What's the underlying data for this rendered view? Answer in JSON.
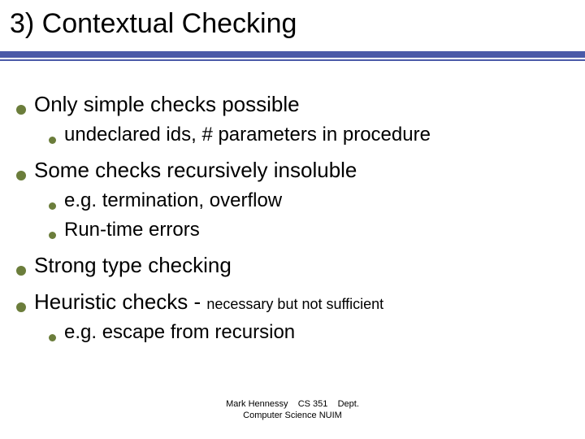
{
  "title": "3) Contextual Checking",
  "items": {
    "p1_lead": "Only",
    "p1_rest": " simple checks possible",
    "p1_sub1": "undeclared ids, # parameters in procedure",
    "p2_lead": "Some",
    "p2_rest": " checks recursively insoluble",
    "p2_sub1": "e.g. termination, overflow",
    "p2_sub2": "Run-time errors",
    "p3_lead": "Strong",
    "p3_rest": " type checking",
    "p4_lead": "Heuristic",
    "p4_rest_a": " checks - ",
    "p4_small": "necessary but not sufficient",
    "p4_sub1": "e.g. escape from recursion"
  },
  "footer": {
    "line1": "Mark Hennessy    CS 351    Dept.",
    "line2": "Computer Science NUIM"
  }
}
